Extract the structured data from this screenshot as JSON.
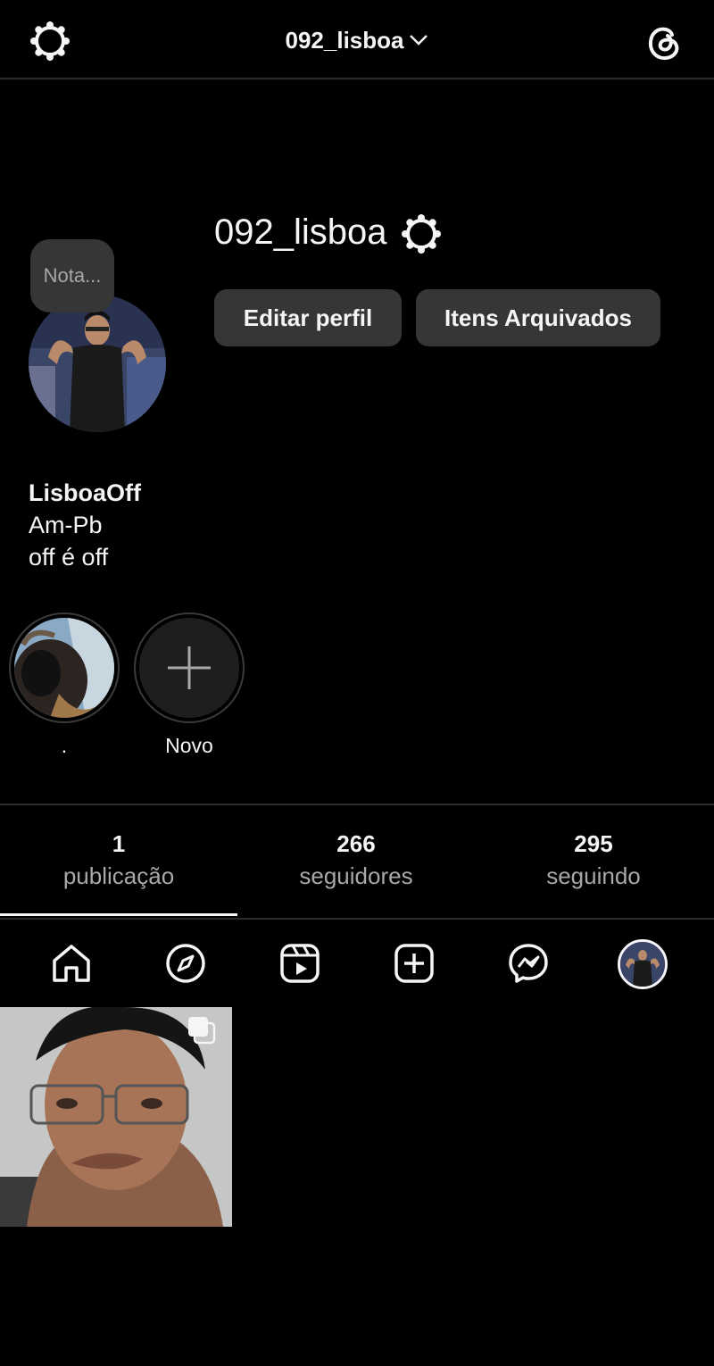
{
  "header": {
    "username": "092_lisboa"
  },
  "profile": {
    "username": "092_lisboa",
    "note_placeholder": "Nota...",
    "edit_button": "Editar perfil",
    "archive_button": "Itens Arquivados",
    "display_name": "LisboaOff",
    "bio_lines": [
      "Am-Pb",
      "off é off"
    ]
  },
  "highlights": [
    {
      "label": "."
    },
    {
      "label": "Novo"
    }
  ],
  "stats": [
    {
      "value": "1",
      "label": "publicação"
    },
    {
      "value": "266",
      "label": "seguidores"
    },
    {
      "value": "295",
      "label": "seguindo"
    }
  ],
  "nav": {
    "icons": [
      "home-icon",
      "explore-icon",
      "reels-icon",
      "create-icon",
      "messenger-icon",
      "profile-avatar"
    ]
  },
  "colors": {
    "background": "#000000",
    "button": "#363636",
    "text_primary": "#f5f5f5",
    "text_secondary": "#a8a8a8",
    "divider": "#2a2a2a"
  }
}
